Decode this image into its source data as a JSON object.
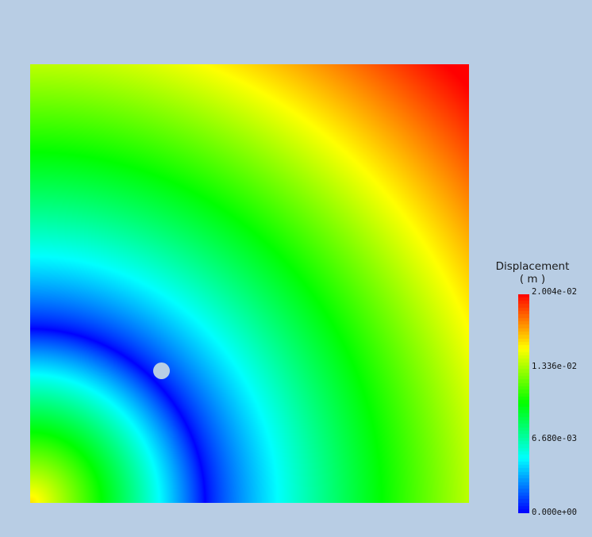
{
  "legend": {
    "title": "Displacement",
    "unit": "( m )",
    "ticks": [
      "2.004e-02",
      "1.336e-02",
      "6.680e-03",
      "0.000e+00"
    ],
    "min": 0.0,
    "max": 0.02004
  },
  "colors": {
    "background": "#b8cde4",
    "colormap": [
      "#0000ff",
      "#00ffff",
      "#00ff00",
      "#ffff00",
      "#ff0000"
    ]
  }
}
